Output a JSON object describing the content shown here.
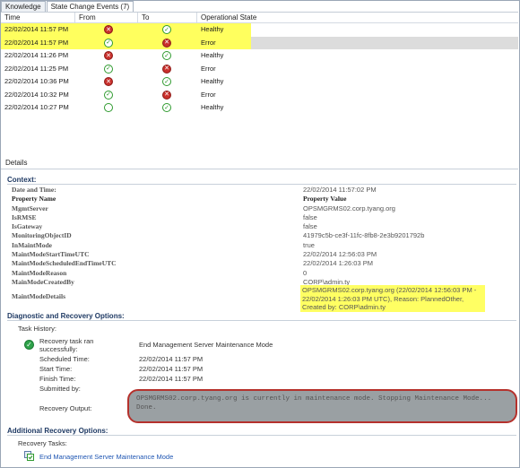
{
  "tabs": [
    {
      "label": "Knowledge",
      "active": false
    },
    {
      "label": "State Change Events (7)",
      "active": true
    }
  ],
  "grid": {
    "columns": [
      "Time",
      "From",
      "To",
      "Operational State"
    ],
    "rows": [
      {
        "time": "22/02/2014 11:57 PM",
        "from": "error",
        "to": "healthy",
        "state": "Healthy",
        "highlight": "yellow"
      },
      {
        "time": "22/02/2014 11:57 PM",
        "from": "healthy",
        "to": "error",
        "state": "Error",
        "highlight": "selected"
      },
      {
        "time": "22/02/2014 11:26 PM",
        "from": "error",
        "to": "healthy",
        "state": "Healthy",
        "highlight": "none"
      },
      {
        "time": "22/02/2014 11:25 PM",
        "from": "healthy",
        "to": "error",
        "state": "Error",
        "highlight": "none"
      },
      {
        "time": "22/02/2014 10:36 PM",
        "from": "error",
        "to": "healthy",
        "state": "Healthy",
        "highlight": "none"
      },
      {
        "time": "22/02/2014 10:32 PM",
        "from": "healthy",
        "to": "error",
        "state": "Error",
        "highlight": "none"
      },
      {
        "time": "22/02/2014 10:27 PM",
        "from": "empty",
        "to": "healthy",
        "state": "Healthy",
        "highlight": "none"
      }
    ]
  },
  "details": {
    "label": "Details",
    "context_title": "Context:",
    "context": [
      {
        "k": "Date and Time:",
        "v": "22/02/2014 11:57:02 PM"
      },
      {
        "k": "Property Name",
        "v": "Property Value",
        "head": true
      },
      {
        "k": "MgmtServer",
        "v": "OPSMGRMS02.corp.tyang.org"
      },
      {
        "k": "IsRMSE",
        "v": "false"
      },
      {
        "k": "IsGateway",
        "v": "false"
      },
      {
        "k": "MonitoringObjectID",
        "v": "41979c5b-ce3f-11fc-8fb8-2e3b9201792b"
      },
      {
        "k": "InMaintMode",
        "v": "true"
      },
      {
        "k": "MaintModeStartTimeUTC",
        "v": "22/02/2014 12:56:03 PM"
      },
      {
        "k": "MaintModeScheduledEndTimeUTC",
        "v": "22/02/2014 1:26:03 PM"
      },
      {
        "k": "MaintModeReason",
        "v": "0"
      },
      {
        "k": "MainModeCreatedBy",
        "v": "CORP\\admin.ty"
      }
    ],
    "maint_details_key": "MaintModeDetails",
    "maint_details_lines": [
      "OPSMGRMS02.corp.tyang.org (22/02/2014 12:56:03 PM -",
      "22/02/2014 1:26:03 PM UTC), Reason: PlannedOther,",
      "Created by: CORP\\admin.ty"
    ],
    "diag_title": "Diagnostic and Recovery Options:",
    "task_history_label": "Task History:",
    "task": {
      "status_lines": [
        "Recovery task ran",
        "successfully:"
      ],
      "name": "End Management Server Maintenance Mode",
      "scheduled_label": "Scheduled Time:",
      "scheduled_value": "22/02/2014 11:57 PM",
      "start_label": "Start Time:",
      "start_value": "22/02/2014 11:57 PM",
      "finish_label": "Finish Time:",
      "finish_value": "22/02/2014 11:57 PM",
      "submitted_label": "Submitted by:",
      "output_label": "Recovery Output:",
      "output_lines": [
        "OPSMGRMS02.corp.tyang.org is currently in maintenance mode. Stopping Maintenance Mode...",
        "Done."
      ]
    },
    "additional_title": "Additional Recovery Options:",
    "recovery_tasks_label": "Recovery Tasks:",
    "recovery_link": "End Management Server Maintenance Mode"
  }
}
